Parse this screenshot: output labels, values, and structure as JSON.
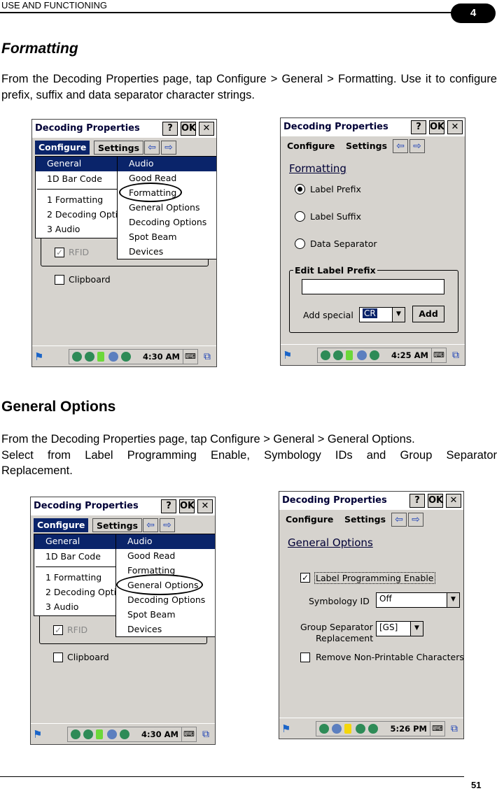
{
  "header": {
    "title": "USE AND FUNCTIONING",
    "chapter": "4"
  },
  "sections": {
    "formatting": {
      "heading": "Formatting",
      "para": "From the Decoding Properties page, tap Configure > General > Formatting. Use it to configure prefix, suffix and data separator character strings."
    },
    "general": {
      "heading": "General Options",
      "para1": "From the Decoding Properties page, tap Configure > General > General Options.",
      "para2": "Select from Label Programming Enable, Symbology IDs and Group Separator",
      "para3": "Replacement."
    }
  },
  "device": {
    "title": "Decoding Properties",
    "help_btn": "?",
    "ok_btn": "OK",
    "close_btn": "✕",
    "menu_configure": "Configure",
    "menu_settings": "Settings",
    "arrow_left": "⇦",
    "arrow_right": "⇨",
    "keyboard_icon": "⌨",
    "windows_icon": "⧉",
    "start_icon": "⚑",
    "configure_menu": [
      "General",
      "1D Bar Code",
      "1 Formatting",
      "2 Decoding Opti",
      "3 Audio"
    ],
    "general_submenu": [
      "Audio",
      "Good Read",
      "Formatting",
      "General Options",
      "Decoding Options",
      "Spot Beam",
      "Devices"
    ],
    "rfid_label": "RFID",
    "clipboard_label": "Clipboard"
  },
  "screen1": {
    "time": "4:30 AM"
  },
  "screen2": {
    "time": "4:25 AM",
    "section_title": "Formatting",
    "radio_prefix": "Label Prefix",
    "radio_suffix": "Label Suffix",
    "radio_separator": "Data Separator",
    "group_title": "Edit Label Prefix",
    "add_special_label": "Add special",
    "add_special_value": "CR",
    "add_button": "Add"
  },
  "screen3": {
    "time": "4:30 AM"
  },
  "screen4": {
    "time": "5:26 PM",
    "section_title": "General Options",
    "label_prog_enable": "Label Programming Enable",
    "symbology_id_label": "Symbology ID",
    "symbology_id_value": "Off",
    "group_sep_label_1": "Group Separator",
    "group_sep_label_2": "Replacement",
    "group_sep_value": "[GS]",
    "remove_nonprintable": "Remove Non-Printable Characters"
  },
  "footer": {
    "page": "51"
  }
}
